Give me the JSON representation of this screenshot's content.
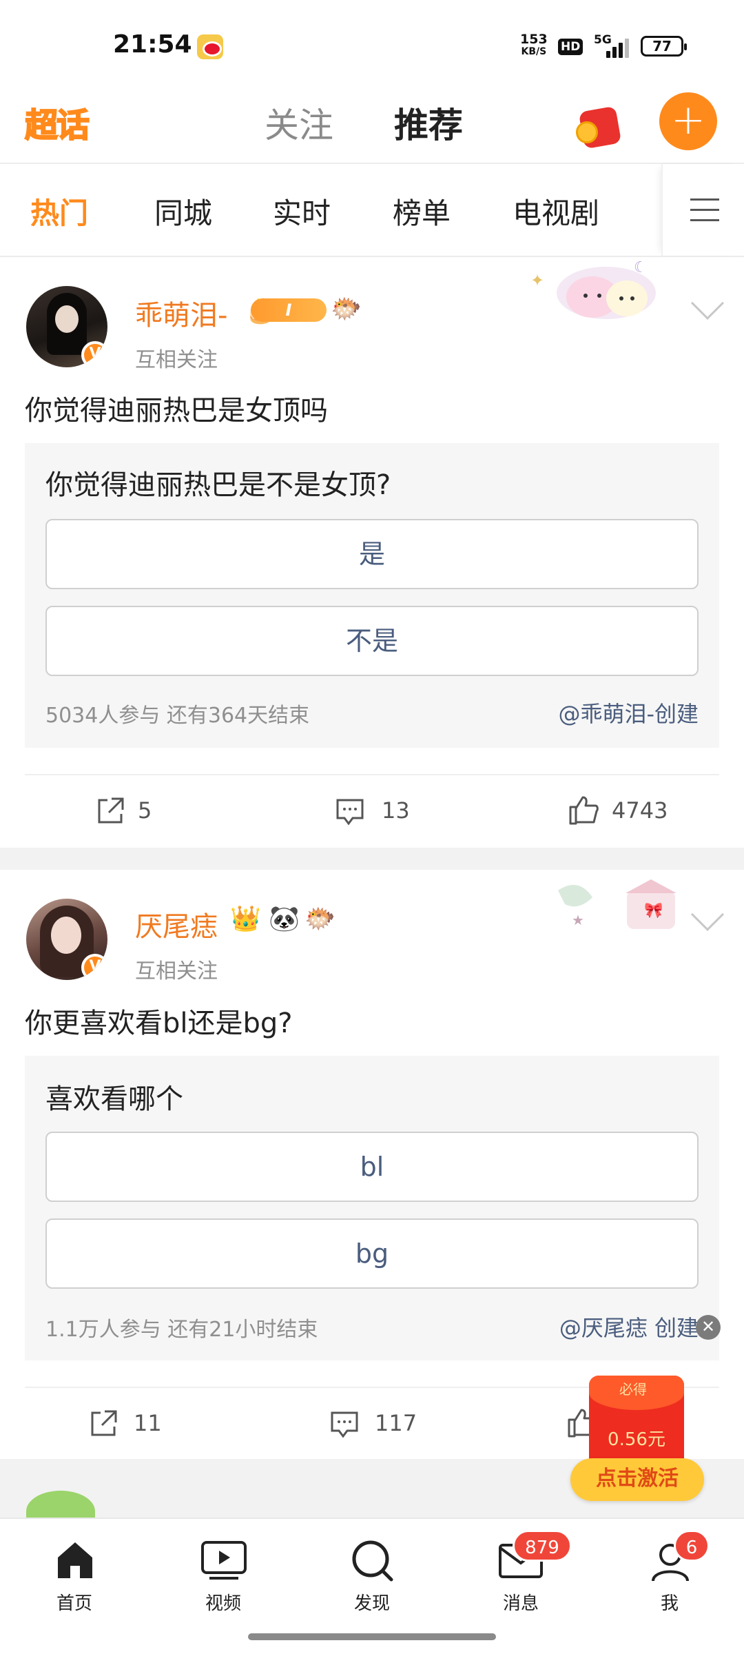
{
  "status_bar": {
    "time": "21:54",
    "net_speed_value": "153",
    "net_speed_unit": "KB/S",
    "hd": "HD",
    "network": "5G",
    "battery": "77"
  },
  "header": {
    "logo": "超话",
    "tabs": [
      {
        "label": "关注",
        "active": false
      },
      {
        "label": "推荐",
        "active": true
      }
    ],
    "accent_color": "#ff8a1c"
  },
  "subtabs": [
    {
      "label": "热门",
      "active": true
    },
    {
      "label": "同城",
      "active": false
    },
    {
      "label": "实时",
      "active": false
    },
    {
      "label": "榜单",
      "active": false
    },
    {
      "label": "电视剧",
      "active": false
    }
  ],
  "posts": [
    {
      "username": "乖萌泪-",
      "level_badge": "I",
      "relation": "互相关注",
      "text": "你觉得迪丽热巴是女顶吗",
      "vote": {
        "question": "你觉得迪丽热巴是不是女顶?",
        "options": [
          "是",
          "不是"
        ],
        "meta": "5034人参与 还有364天结束",
        "creator": "@乖萌泪-创建"
      },
      "actions": {
        "shares": "5",
        "comments": "13",
        "likes": "4743"
      }
    },
    {
      "username": "厌尾痣",
      "relation": "互相关注",
      "text": "你更喜欢看bl还是bg?",
      "vote": {
        "question": "喜欢看哪个",
        "options": [
          "bl",
          "bg"
        ],
        "meta": "1.1万人参与 还有21小时结束",
        "creator": "@厌尾痣 创建"
      },
      "actions": {
        "shares": "11",
        "comments": "117"
      }
    }
  ],
  "floating_ad": {
    "tag": "必得",
    "amount": "0.56元",
    "cta": "点击激活"
  },
  "bottom_nav": [
    {
      "label": "首页",
      "icon": "home-icon",
      "active": true
    },
    {
      "label": "视频",
      "icon": "video-icon"
    },
    {
      "label": "发现",
      "icon": "search-icon"
    },
    {
      "label": "消息",
      "icon": "mail-icon",
      "badge": "879"
    },
    {
      "label": "我",
      "icon": "profile-icon",
      "badge": "6"
    }
  ]
}
